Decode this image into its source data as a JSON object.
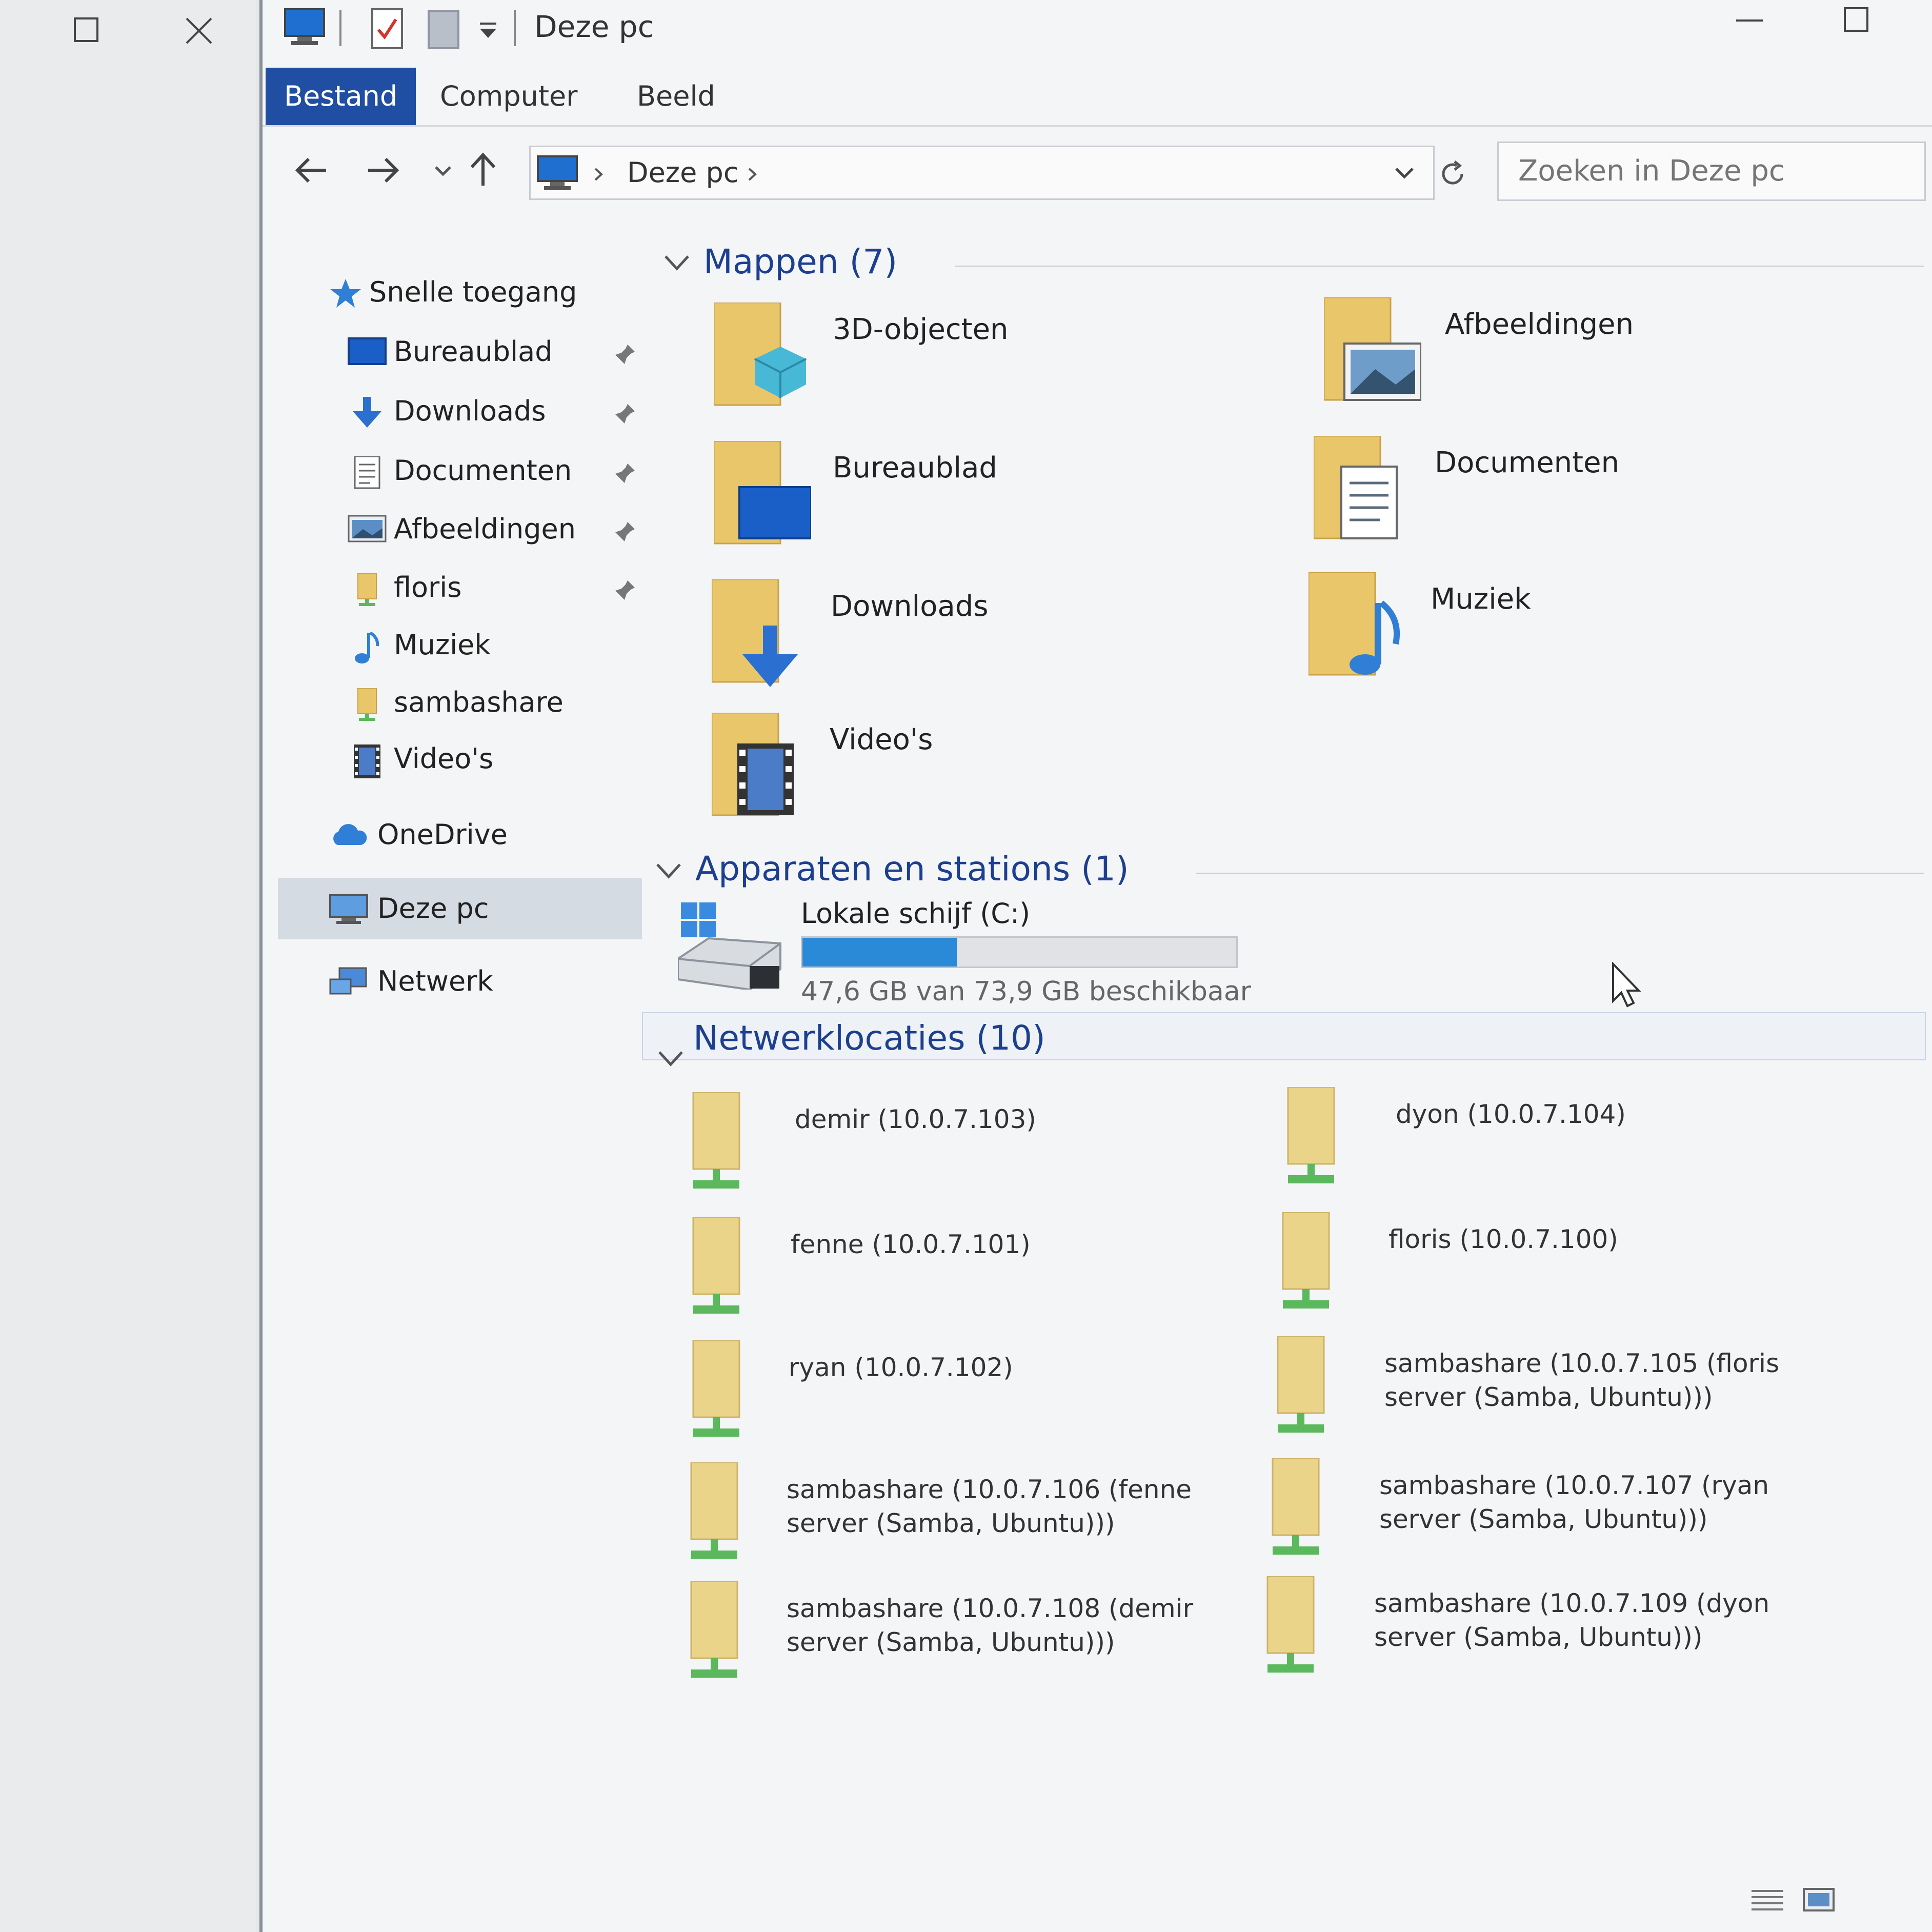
{
  "background_window": {},
  "window": {
    "title": "Deze pc"
  },
  "ribbon": {
    "tabs": [
      "Bestand",
      "Computer",
      "Beeld"
    ]
  },
  "address": {
    "path": "Deze pc",
    "search_placeholder": "Zoeken in Deze pc"
  },
  "sidebar": {
    "quick_access": "Snelle toegang",
    "items": [
      {
        "label": "Bureaublad",
        "pinned": true
      },
      {
        "label": "Downloads",
        "pinned": true
      },
      {
        "label": "Documenten",
        "pinned": true
      },
      {
        "label": "Afbeeldingen",
        "pinned": true
      },
      {
        "label": "floris",
        "pinned": true
      },
      {
        "label": "Muziek",
        "pinned": false
      },
      {
        "label": "sambashare",
        "pinned": false
      },
      {
        "label": "Video's",
        "pinned": false
      }
    ],
    "onedrive": "OneDrive",
    "this_pc": "Deze pc",
    "network": "Netwerk"
  },
  "folders": {
    "header": "Mappen (7)",
    "items": [
      "3D-objecten",
      "Afbeeldingen",
      "Bureaublad",
      "Documenten",
      "Downloads",
      "Muziek",
      "Video's"
    ]
  },
  "devices": {
    "header": "Apparaten en stations (1)",
    "drive_name": "Lokale schijf (C:)",
    "drive_free": "47,6 GB van 73,9 GB beschikbaar",
    "used_fraction": 0.356
  },
  "network_locations": {
    "header": "Netwerklocaties (10)",
    "items": [
      "demir (10.0.7.103)",
      "dyon (10.0.7.104)",
      "fenne (10.0.7.101)",
      "floris (10.0.7.100)",
      "ryan (10.0.7.102)",
      "sambashare (10.0.7.105 (floris server (Samba, Ubuntu)))",
      "sambashare (10.0.7.106 (fenne server (Samba, Ubuntu)))",
      "sambashare (10.0.7.107 (ryan server (Samba, Ubuntu)))",
      "sambashare (10.0.7.108 (demir server (Samba, Ubuntu)))",
      "sambashare (10.0.7.109 (dyon server (Samba, Ubuntu)))"
    ]
  },
  "colors": {
    "accent": "#1f4ea3",
    "section_header": "#1d3f8f",
    "drive_fill": "#2a8ad8",
    "folder": "#e9c66a",
    "network_plug": "#5cb85c"
  }
}
